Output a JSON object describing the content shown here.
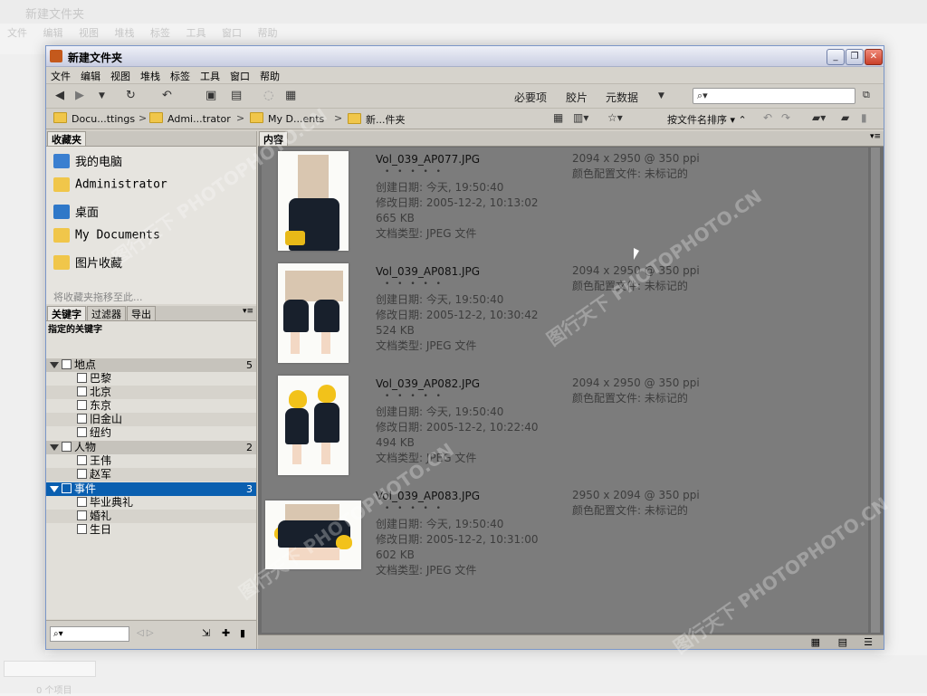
{
  "background": {
    "title": "新建文件夹",
    "menu": [
      "文件",
      "编辑",
      "视图",
      "堆栈",
      "标签",
      "工具",
      "窗口",
      "帮助"
    ],
    "bottom_label": "0 个项目"
  },
  "window": {
    "title": "新建文件夹",
    "min": "_",
    "restore": "❐",
    "close": "✕"
  },
  "menu": [
    "文件",
    "编辑",
    "视图",
    "堆栈",
    "标签",
    "工具",
    "窗口",
    "帮助"
  ],
  "toolbar": {
    "workspace_essentials": "必要项",
    "workspace_filmstrip": "胶片",
    "workspace_metadata": "元数据",
    "search_placeholder": "",
    "sort_label": "按文件名排序"
  },
  "breadcrumb": [
    {
      "label": "Docu...ttings"
    },
    {
      "label": "Admi...trator"
    },
    {
      "label": "My D...ents"
    },
    {
      "label": "新...件夹"
    }
  ],
  "favorites": {
    "tab": "收藏夹",
    "items": [
      {
        "label": "我的电脑",
        "icon": "computer-icon"
      },
      {
        "label": "Administrator",
        "icon": "folder-icon"
      },
      {
        "label": "桌面",
        "icon": "desktop-icon"
      },
      {
        "label": "My Documents",
        "icon": "folder-icon"
      },
      {
        "label": "图片收藏",
        "icon": "folder-icon"
      }
    ],
    "hint": "将收藏夹拖移至此..."
  },
  "keywords": {
    "tabs": [
      "关键字",
      "过滤器",
      "导出"
    ],
    "subtitle": "指定的关键字",
    "categories": [
      {
        "name": "地点",
        "count": "5",
        "items": [
          "巴黎",
          "北京",
          "东京",
          "旧金山",
          "纽约"
        ]
      },
      {
        "name": "人物",
        "count": "2",
        "items": [
          "王伟",
          "赵军"
        ]
      },
      {
        "name": "事件",
        "count": "3",
        "items": [
          "毕业典礼",
          "婚礼",
          "生日"
        ]
      }
    ]
  },
  "content": {
    "tab": "内容",
    "files": [
      {
        "name": "Vol_039_AP077.JPG",
        "stars": "• • • • •",
        "created": "创建日期: 今天, 19:50:40",
        "modified": "修改日期: 2005-12-2, 10:13:02",
        "size": "665 KB",
        "type": "文档类型: JPEG 文件",
        "dims": "2094 x 2950 @ 350 ppi",
        "profile": "颜色配置文件: 未标记的"
      },
      {
        "name": "Vol_039_AP081.JPG",
        "stars": "• • • • •",
        "created": "创建日期: 今天, 19:50:40",
        "modified": "修改日期: 2005-12-2, 10:30:42",
        "size": "524 KB",
        "type": "文档类型: JPEG 文件",
        "dims": "2094 x 2950 @ 350 ppi",
        "profile": "颜色配置文件: 未标记的"
      },
      {
        "name": "Vol_039_AP082.JPG",
        "stars": "• • • • •",
        "created": "创建日期: 今天, 19:50:40",
        "modified": "修改日期: 2005-12-2, 10:22:40",
        "size": "494 KB",
        "type": "文档类型: JPEG 文件",
        "dims": "2094 x 2950 @ 350 ppi",
        "profile": "颜色配置文件: 未标记的"
      },
      {
        "name": "Vol_039_AP083.JPG",
        "stars": "• • • • •",
        "created": "创建日期: 今天, 19:50:40",
        "modified": "修改日期: 2005-12-2, 10:31:00",
        "size": "602 KB",
        "type": "文档类型: JPEG 文件",
        "dims": "2950 x 2094 @ 350 ppi",
        "profile": "颜色配置文件: 未标记的"
      }
    ]
  },
  "watermark": "图行天下 PHOTOPHOTO.CN"
}
